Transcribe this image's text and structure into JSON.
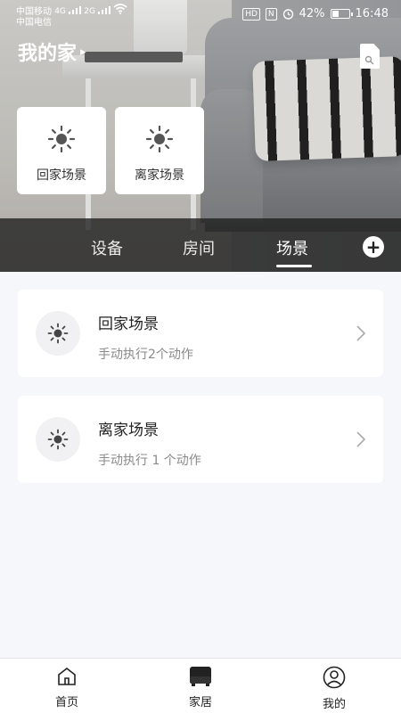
{
  "status_bar": {
    "carrier1": "中国移动",
    "carrier2": "中国电信",
    "net1": "4G",
    "net2": "2G",
    "hd": "HD",
    "nfc": "N",
    "battery": "42%",
    "battery_level": 0.42,
    "time": "16:48"
  },
  "header": {
    "home_name": "我的家",
    "arrow": "▸"
  },
  "quick_scenes": [
    {
      "label": "回家场景",
      "icon": "sun-icon"
    },
    {
      "label": "离家场景",
      "icon": "sun-icon"
    }
  ],
  "tabs": [
    {
      "label": "设备"
    },
    {
      "label": "房间"
    },
    {
      "label": "场景",
      "active": true
    }
  ],
  "add_button": "+",
  "scenes": [
    {
      "title": "回家场景",
      "subtitle": "手动执行2个动作",
      "icon": "sun-icon"
    },
    {
      "title": "离家场景",
      "subtitle": "手动执行 1 个动作",
      "icon": "sun-icon"
    }
  ],
  "bottom_nav": [
    {
      "label": "首页",
      "icon": "home-icon"
    },
    {
      "label": "家居",
      "icon": "device-icon",
      "active": true
    },
    {
      "label": "我的",
      "icon": "user-icon"
    }
  ],
  "colors": {
    "background": "#f6f7fa",
    "card": "#ffffff",
    "text_primary": "#222222",
    "text_secondary": "#8a8a8a"
  }
}
